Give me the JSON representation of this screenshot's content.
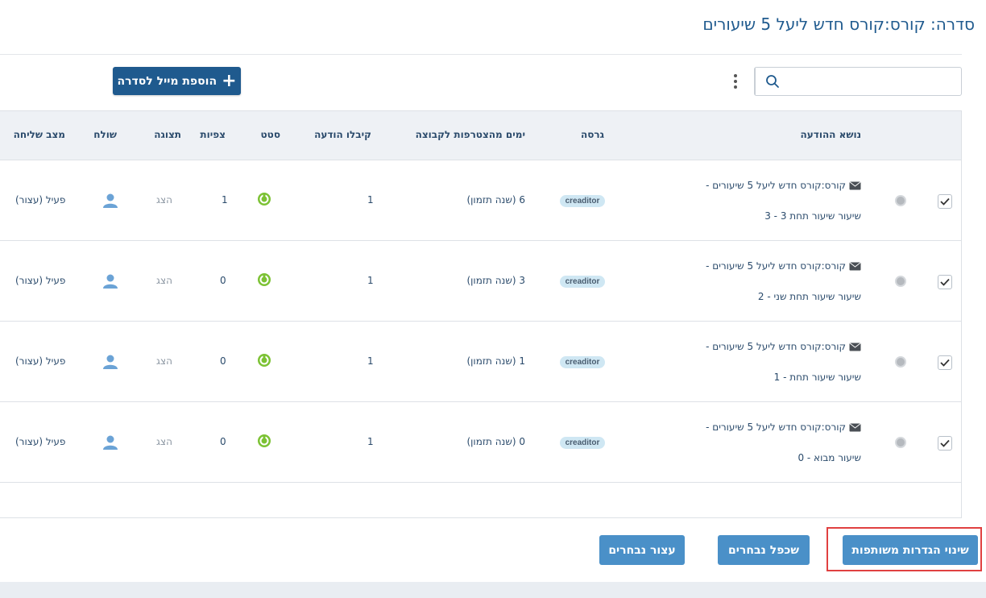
{
  "page": {
    "title": "סדרה: קורס:קורס חדש ליעל 5 שיעורים"
  },
  "toolbar": {
    "search_placeholder": "",
    "search_icon": "search-icon",
    "more_icon": "more-vertical-icon",
    "add_button_label": "הוספת מייל לסדרה",
    "add_icon": "plus-icon"
  },
  "table": {
    "headers": {
      "subject": "נושא ההודעה",
      "version": "גרסה",
      "days": "ימים מהצטרפות לקבוצה",
      "received": "קיבלו הודעה",
      "stats": "סטט",
      "views": "צפיות",
      "preview": "תצוגה",
      "sender": "שולח",
      "status": "מצב שליחה"
    },
    "rows": [
      {
        "checked": true,
        "subject_line1": "קורס:קורס חדש ליעל 5 שיעורים -",
        "subject_line2": "שיעור שיעור תחת 3 - 3",
        "version": "creaditor",
        "days": "6 (שנה תזמון)",
        "received": "1",
        "views": "1",
        "preview": "הצג",
        "status": "פעיל (עצור)"
      },
      {
        "checked": true,
        "subject_line1": "קורס:קורס חדש ליעל 5 שיעורים -",
        "subject_line2": "שיעור שיעור תחת שני - 2",
        "version": "creaditor",
        "days": "3 (שנה תזמון)",
        "received": "1",
        "views": "0",
        "preview": "הצג",
        "status": "פעיל (עצור)"
      },
      {
        "checked": true,
        "subject_line1": "קורס:קורס חדש ליעל 5 שיעורים -",
        "subject_line2": "שיעור שיעור תחת - 1",
        "version": "creaditor",
        "days": "1 (שנה תזמון)",
        "received": "1",
        "views": "0",
        "preview": "הצג",
        "status": "פעיל (עצור)"
      },
      {
        "checked": true,
        "subject_line1": "קורס:קורס חדש ליעל 5 שיעורים -",
        "subject_line2": "שיעור מבוא - 0",
        "version": "creaditor",
        "days": "0 (שנה תזמון)",
        "received": "1",
        "views": "0",
        "preview": "הצג",
        "status": "פעיל (עצור)"
      }
    ]
  },
  "footer": {
    "change_shared_settings": "שינוי הגדרות משותפות",
    "duplicate_selected": "שכפל נבחרים",
    "stop_selected": "עצור נבחרים"
  },
  "colors": {
    "primary": "#1f5a8e",
    "button": "#4a90c8",
    "highlight": "#e04040",
    "badge_bg": "#cfe7f3",
    "stat_green": "#7cc234"
  }
}
